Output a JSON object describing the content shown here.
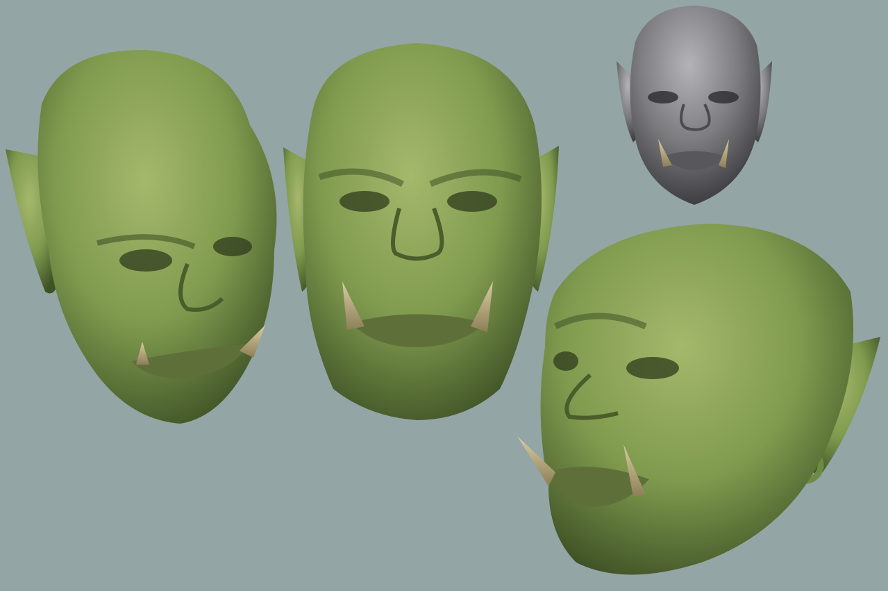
{
  "scene": {
    "background_color": "#94a5a6",
    "skin_color": "#7f9a4e",
    "skin_shadow": "#3f5226",
    "clay_color": "#7c7c7f",
    "clay_shadow": "#3e3e42",
    "tusk_color": "#c7b98c",
    "views": [
      {
        "name": "three-quarter-left",
        "material": "skin"
      },
      {
        "name": "front",
        "material": "skin"
      },
      {
        "name": "front-clay",
        "material": "clay"
      },
      {
        "name": "three-quarter-right",
        "material": "skin"
      }
    ]
  }
}
